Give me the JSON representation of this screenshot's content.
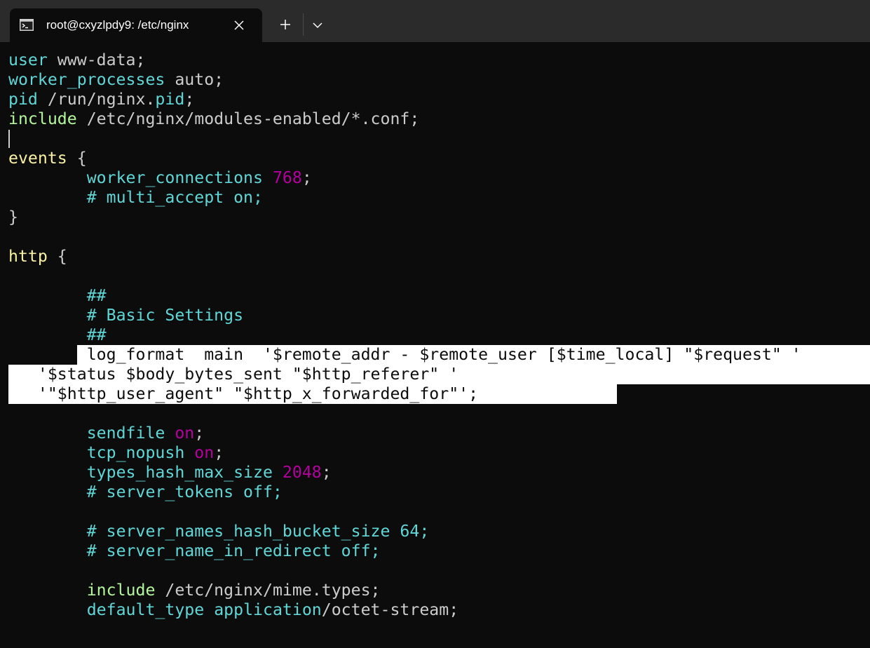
{
  "window": {
    "tab_title": "root@cxyzlpdy9: /etc/nginx",
    "tab_icon": "terminal-icon",
    "close_icon": "close-icon",
    "new_tab_icon": "plus-icon",
    "dropdown_icon": "chevron-down-icon"
  },
  "colors": {
    "background": "#0c0c0c",
    "titlebar": "#2b2b2b",
    "text": "#cccccc",
    "keyword": "#61d6d6",
    "block": "#f9f1a5",
    "include": "#b4f59d",
    "number": "#b4009e",
    "selection_bg": "#ffffff",
    "selection_fg": "#0c0c0c"
  },
  "lines": [
    [
      [
        "user",
        "kw"
      ],
      [
        " www-data;",
        "t"
      ]
    ],
    [
      [
        "worker_processes",
        "kw"
      ],
      [
        " auto;",
        "t"
      ]
    ],
    [
      [
        "pid",
        "kw"
      ],
      [
        " /run/nginx.",
        "t"
      ],
      [
        "pid",
        "kw"
      ],
      [
        ";",
        "t"
      ]
    ],
    [
      [
        "include",
        "inc"
      ],
      [
        " /etc/nginx/modules-enabled/*.conf;",
        "t"
      ]
    ],
    [],
    [
      [
        "events",
        "blk"
      ],
      [
        " {",
        "t"
      ]
    ],
    [
      [
        "        ",
        "t"
      ],
      [
        "worker_connections",
        "kw"
      ],
      [
        " ",
        "t"
      ],
      [
        "768",
        "num"
      ],
      [
        ";",
        "t"
      ]
    ],
    [
      [
        "        ",
        "t"
      ],
      [
        "# multi_accept on;",
        "kw"
      ]
    ],
    [
      [
        "}",
        "t"
      ]
    ],
    [],
    [
      [
        "http",
        "blk"
      ],
      [
        " {",
        "t"
      ]
    ],
    [],
    [
      [
        "        ",
        "t"
      ],
      [
        "##",
        "kw"
      ]
    ],
    [
      [
        "        ",
        "t"
      ],
      [
        "# Basic Settings",
        "kw"
      ]
    ],
    [
      [
        "        ",
        "t"
      ],
      [
        "##",
        "kw"
      ]
    ],
    [
      [
        "        ",
        "t"
      ],
      [
        "log_format  main  '$remote_addr - $remote_user [$time_local] \"$request\" '",
        "sel"
      ]
    ],
    [
      [
        "   ",
        "sel"
      ],
      [
        "'$status $body_bytes_sent \"$http_referer\" '",
        "sel"
      ]
    ],
    [
      [
        "   ",
        "sel"
      ],
      [
        "'\"$http_user_agent\" \"$http_x_forwarded_for\"';",
        "sel"
      ]
    ],
    [],
    [
      [
        "        ",
        "t"
      ],
      [
        "sendfile",
        "kw"
      ],
      [
        " ",
        "t"
      ],
      [
        "on",
        "num"
      ],
      [
        ";",
        "t"
      ]
    ],
    [
      [
        "        ",
        "t"
      ],
      [
        "tcp_nopush",
        "kw"
      ],
      [
        " ",
        "t"
      ],
      [
        "on",
        "num"
      ],
      [
        ";",
        "t"
      ]
    ],
    [
      [
        "        ",
        "t"
      ],
      [
        "types_hash_max_size",
        "kw"
      ],
      [
        " ",
        "t"
      ],
      [
        "2048",
        "num"
      ],
      [
        ";",
        "t"
      ]
    ],
    [
      [
        "        ",
        "t"
      ],
      [
        "# server_tokens off;",
        "kw"
      ]
    ],
    [],
    [
      [
        "        ",
        "t"
      ],
      [
        "# server_names_hash_bucket_size 64;",
        "kw"
      ]
    ],
    [
      [
        "        ",
        "t"
      ],
      [
        "# server_name_in_redirect off;",
        "kw"
      ]
    ],
    [],
    [
      [
        "        ",
        "t"
      ],
      [
        "include",
        "inc"
      ],
      [
        " /etc/nginx/mime.types;",
        "t"
      ]
    ],
    [
      [
        "        ",
        "t"
      ],
      [
        "default_type",
        "kw"
      ],
      [
        " ",
        "t"
      ],
      [
        "application",
        "kw"
      ],
      [
        "/octet-stream;",
        "t"
      ]
    ]
  ]
}
